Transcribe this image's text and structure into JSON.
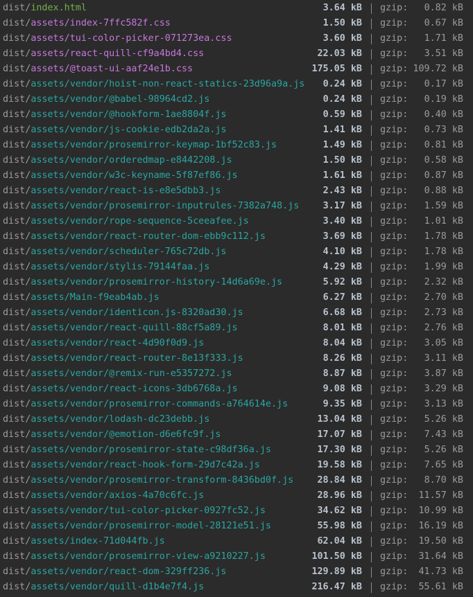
{
  "terminal": {
    "gzip_label": "gzip:",
    "lines": [
      {
        "prefix": "dist/",
        "file": "index.html",
        "file_color": "green",
        "size": "3.64 kB",
        "gzip": "0.82 kB"
      },
      {
        "prefix": "dist/",
        "file": "assets/index-7ffc582f.css",
        "file_color": "purple",
        "size": "1.50 kB",
        "gzip": "0.67 kB"
      },
      {
        "prefix": "dist/",
        "file": "assets/tui-color-picker-071273ea.css",
        "file_color": "purple",
        "size": "3.60 kB",
        "gzip": "1.71 kB"
      },
      {
        "prefix": "dist/",
        "file": "assets/react-quill-cf9a4bd4.css",
        "file_color": "purple",
        "size": "22.03 kB",
        "gzip": "3.51 kB"
      },
      {
        "prefix": "dist/",
        "file": "assets/@toast-ui-aaf24e1b.css",
        "file_color": "purple",
        "size": "175.05 kB",
        "gzip": "109.72 kB"
      },
      {
        "prefix": "dist/",
        "file": "assets/vendor/hoist-non-react-statics-23d96a9a.js",
        "file_color": "teal",
        "size": "0.24 kB",
        "gzip": "0.17 kB"
      },
      {
        "prefix": "dist/",
        "file": "assets/vendor/@babel-98964cd2.js",
        "file_color": "teal",
        "size": "0.24 kB",
        "gzip": "0.19 kB"
      },
      {
        "prefix": "dist/",
        "file": "assets/vendor/@hookform-1ae8804f.js",
        "file_color": "teal",
        "size": "0.59 kB",
        "gzip": "0.40 kB"
      },
      {
        "prefix": "dist/",
        "file": "assets/vendor/js-cookie-edb2da2a.js",
        "file_color": "teal",
        "size": "1.41 kB",
        "gzip": "0.73 kB"
      },
      {
        "prefix": "dist/",
        "file": "assets/vendor/prosemirror-keymap-1bf52c83.js",
        "file_color": "teal",
        "size": "1.49 kB",
        "gzip": "0.81 kB"
      },
      {
        "prefix": "dist/",
        "file": "assets/vendor/orderedmap-e8442208.js",
        "file_color": "teal",
        "size": "1.50 kB",
        "gzip": "0.58 kB"
      },
      {
        "prefix": "dist/",
        "file": "assets/vendor/w3c-keyname-5f87ef86.js",
        "file_color": "teal",
        "size": "1.61 kB",
        "gzip": "0.87 kB"
      },
      {
        "prefix": "dist/",
        "file": "assets/vendor/react-is-e8e5dbb3.js",
        "file_color": "teal",
        "size": "2.43 kB",
        "gzip": "0.88 kB"
      },
      {
        "prefix": "dist/",
        "file": "assets/vendor/prosemirror-inputrules-7382a748.js",
        "file_color": "teal",
        "size": "3.17 kB",
        "gzip": "1.59 kB"
      },
      {
        "prefix": "dist/",
        "file": "assets/vendor/rope-sequence-5ceeafee.js",
        "file_color": "teal",
        "size": "3.40 kB",
        "gzip": "1.01 kB"
      },
      {
        "prefix": "dist/",
        "file": "assets/vendor/react-router-dom-ebb9c112.js",
        "file_color": "teal",
        "size": "3.69 kB",
        "gzip": "1.78 kB"
      },
      {
        "prefix": "dist/",
        "file": "assets/vendor/scheduler-765c72db.js",
        "file_color": "teal",
        "size": "4.10 kB",
        "gzip": "1.78 kB"
      },
      {
        "prefix": "dist/",
        "file": "assets/vendor/stylis-79144faa.js",
        "file_color": "teal",
        "size": "4.29 kB",
        "gzip": "1.99 kB"
      },
      {
        "prefix": "dist/",
        "file": "assets/vendor/prosemirror-history-14d6a69e.js",
        "file_color": "teal",
        "size": "5.92 kB",
        "gzip": "2.32 kB"
      },
      {
        "prefix": "dist/",
        "file": "assets/Main-f9eab4ab.js",
        "file_color": "teal",
        "size": "6.27 kB",
        "gzip": "2.70 kB"
      },
      {
        "prefix": "dist/",
        "file": "assets/vendor/identicon.js-8320ad30.js",
        "file_color": "teal",
        "size": "6.68 kB",
        "gzip": "2.73 kB"
      },
      {
        "prefix": "dist/",
        "file": "assets/vendor/react-quill-88cf5a89.js",
        "file_color": "teal",
        "size": "8.01 kB",
        "gzip": "2.76 kB"
      },
      {
        "prefix": "dist/",
        "file": "assets/vendor/react-4d90f0d9.js",
        "file_color": "teal",
        "size": "8.04 kB",
        "gzip": "3.05 kB"
      },
      {
        "prefix": "dist/",
        "file": "assets/vendor/react-router-8e13f333.js",
        "file_color": "teal",
        "size": "8.26 kB",
        "gzip": "3.11 kB"
      },
      {
        "prefix": "dist/",
        "file": "assets/vendor/@remix-run-e5357272.js",
        "file_color": "teal",
        "size": "8.87 kB",
        "gzip": "3.87 kB"
      },
      {
        "prefix": "dist/",
        "file": "assets/vendor/react-icons-3db6768a.js",
        "file_color": "teal",
        "size": "9.08 kB",
        "gzip": "3.29 kB"
      },
      {
        "prefix": "dist/",
        "file": "assets/vendor/prosemirror-commands-a764614e.js",
        "file_color": "teal",
        "size": "9.35 kB",
        "gzip": "3.13 kB"
      },
      {
        "prefix": "dist/",
        "file": "assets/vendor/lodash-dc23debb.js",
        "file_color": "teal",
        "size": "13.04 kB",
        "gzip": "5.26 kB"
      },
      {
        "prefix": "dist/",
        "file": "assets/vendor/@emotion-d6e6fc9f.js",
        "file_color": "teal",
        "size": "17.07 kB",
        "gzip": "7.43 kB"
      },
      {
        "prefix": "dist/",
        "file": "assets/vendor/prosemirror-state-c98df36a.js",
        "file_color": "teal",
        "size": "17.30 kB",
        "gzip": "5.26 kB"
      },
      {
        "prefix": "dist/",
        "file": "assets/vendor/react-hook-form-29d7c42a.js",
        "file_color": "teal",
        "size": "19.58 kB",
        "gzip": "7.65 kB"
      },
      {
        "prefix": "dist/",
        "file": "assets/vendor/prosemirror-transform-8436bd0f.js",
        "file_color": "teal",
        "size": "28.84 kB",
        "gzip": "8.70 kB"
      },
      {
        "prefix": "dist/",
        "file": "assets/vendor/axios-4a70c6fc.js",
        "file_color": "teal",
        "size": "28.96 kB",
        "gzip": "11.57 kB"
      },
      {
        "prefix": "dist/",
        "file": "assets/vendor/tui-color-picker-0927fc52.js",
        "file_color": "teal",
        "size": "34.62 kB",
        "gzip": "10.99 kB"
      },
      {
        "prefix": "dist/",
        "file": "assets/vendor/prosemirror-model-28121e51.js",
        "file_color": "teal",
        "size": "55.98 kB",
        "gzip": "16.19 kB"
      },
      {
        "prefix": "dist/",
        "file": "assets/index-71d044fb.js",
        "file_color": "teal",
        "size": "62.04 kB",
        "gzip": "19.50 kB"
      },
      {
        "prefix": "dist/",
        "file": "assets/vendor/prosemirror-view-a9210227.js",
        "file_color": "teal",
        "size": "101.50 kB",
        "gzip": "31.64 kB"
      },
      {
        "prefix": "dist/",
        "file": "assets/vendor/react-dom-329ff236.js",
        "file_color": "teal",
        "size": "129.89 kB",
        "gzip": "41.73 kB"
      },
      {
        "prefix": "dist/",
        "file": "assets/vendor/quill-d1b4e7f4.js",
        "file_color": "teal",
        "size": "216.47 kB",
        "gzip": "55.61 kB"
      }
    ]
  }
}
